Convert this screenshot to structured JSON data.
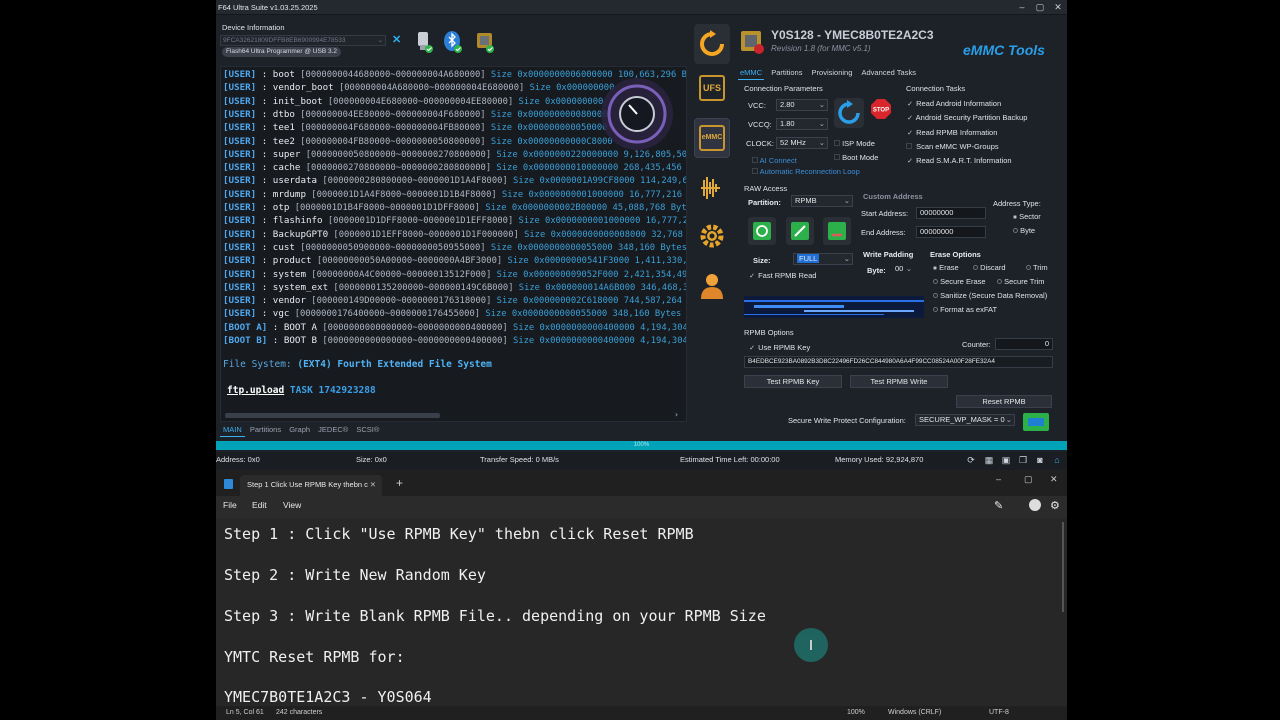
{
  "app": {
    "title": "F64 Ultra Suite v1.03.25.2025",
    "device_info_label": "Device Information",
    "device_select": "9FCA32621809DFFB8EB6900994E78533",
    "port_label": "Flash64 Ultra Programmer @ USB 3.2"
  },
  "log": {
    "rows": [
      {
        "tag": "[USER]",
        "name": " : boot",
        "range": " [0000000044680000~000000004A680000]",
        "size": " Size 0x0000000006000000 100,663,296 Byte"
      },
      {
        "tag": "[USER]",
        "name": " : vendor_boot",
        "range": " [000000004A680000~000000004E680000]",
        "size": " Size 0x000000000"
      },
      {
        "tag": "[USER]",
        "name": " : init_boot",
        "range": " [000000004E680000~000000004EE80000]",
        "size": " Size 0x000000000"
      },
      {
        "tag": "[USER]",
        "name": " : dtbo",
        "range": " [000000004EE80000~000000004F680000]",
        "size": " Size 0x000000000080000"
      },
      {
        "tag": "[USER]",
        "name": " : tee1",
        "range": " [000000004F680000~000000004FB80000]",
        "size": " Size 0x000000000050000"
      },
      {
        "tag": "[USER]",
        "name": " : tee2",
        "range": " [000000004FB80000~0000000050800000]",
        "size": " Size 0x00000000000C8000"
      },
      {
        "tag": "[USER]",
        "name": " : super",
        "range": " [0000000050800000~0000000270800000]",
        "size": " Size 0x0000000220000000 9,126,805,504 B"
      },
      {
        "tag": "[USER]",
        "name": " : cache",
        "range": " [0000000270800000~0000000280800000]",
        "size": " Size 0x0000000010000000 268,435,456 Byt"
      },
      {
        "tag": "[USER]",
        "name": " : userdata",
        "range": " [0000000280800000~0000001D1A4F8000]",
        "size": " Size 0x0000001A99CF8000 114,249,662"
      },
      {
        "tag": "[USER]",
        "name": " : mrdump",
        "range": " [0000001D1A4F8000~0000001D1B4F8000]",
        "size": " Size 0x0000000001000000 16,777,216"
      },
      {
        "tag": "[USER]",
        "name": " : otp",
        "range": " [0000001D1B4F8000~0000001D1DFF8000]",
        "size": " Size 0x0000000002B00000 45,088,768 Bytes"
      },
      {
        "tag": "[USER]",
        "name": " : flashinfo",
        "range": " [0000001D1DFF8000~0000001D1EFF8000]",
        "size": " Size 0x0000000001000000 16,777,216"
      },
      {
        "tag": "[USER]",
        "name": " : BackupGPT0",
        "range": " [0000001D1EFF8000~0000001D1F000000]",
        "size": " Size 0x0000000000008000 32,768 B"
      },
      {
        "tag": "[USER]",
        "name": " : cust",
        "range": " [0000000050900000~0000000050955000]",
        "size": " Size 0x0000000000055000 348,160 Bytes (34"
      },
      {
        "tag": "[USER]",
        "name": " : product",
        "range": " [00000000050A00000~0000000A4BF3000]",
        "size": " Size 0x00000000541F3000 1,411,330,04"
      },
      {
        "tag": "[USER]",
        "name": " : system",
        "range": " [00000000A4C00000~00000013512F000]",
        "size": " Size 0x000000009052F000 2,421,354,496"
      },
      {
        "tag": "[USER]",
        "name": " : system_ext",
        "range": " [0000000135200000~000000149C6B000]",
        "size": " Size 0x000000014A6B000 346,468,3"
      },
      {
        "tag": "[USER]",
        "name": " : vendor",
        "range": " [000000149D00000~0000000176318000]",
        "size": " Size 0x000000002C618000 744,587,264 B"
      },
      {
        "tag": "[USER]",
        "name": " : vgc",
        "range": " [0000000176400000~0000000176455000]",
        "size": " Size 0x0000000000055000 348,160 Bytes (34"
      },
      {
        "tag": "[BOOT A]",
        "name": " : BOOT A",
        "range": " [0000000000000000~0000000000400000]",
        "size": " Size 0x0000000000400000 4,194,304 B"
      },
      {
        "tag": "[BOOT B]",
        "name": " : BOOT B",
        "range": " [0000000000000000~0000000000400000]",
        "size": " Size 0x0000000000400000 4,194,304 B"
      }
    ],
    "fs_label": "File System: ",
    "fs_value": "(EXT4) Fourth Extended File System",
    "ftp_label": "ftp.upload",
    "ftp_task": " TASK 1742923288",
    "tabs": [
      "MAIN",
      "Partitions",
      "Graph",
      "JEDEC®",
      "SCSI®"
    ]
  },
  "progress": {
    "text": "100%",
    "value": 1.0
  },
  "status": {
    "address": "Address: 0x0",
    "size": "Size: 0x0",
    "speed": "Transfer Speed: 0 MB/s",
    "eta": "Estimated Time Left: 00:00:00",
    "memory": "Memory Used: 92,924,870"
  },
  "header": {
    "title": "Y0S128 - YMEC8B0TE2A2C3",
    "revision": "Revision 1.8 (for MMC v5.1)",
    "brand": "eMMC Tools",
    "tabs": [
      "eMMC",
      "Partitions",
      "Provisioning",
      "Advanced Tasks"
    ],
    "sidebar_ufs": "UFS",
    "sidebar_emmc": "eMMC",
    "stop_label": "STOP"
  },
  "conn": {
    "group_label": "Connection Parameters",
    "vcc_label": "VCC:",
    "vcc_value": "2.80",
    "vccq_label": "VCCQ:",
    "vccq_value": "1.80",
    "clock_label": "CLOCK:",
    "clock_value": "52 MHz",
    "isp_label": "ISP Mode",
    "boot_label": "Boot Mode",
    "ai_connect": "AI Connect",
    "auto_reconnect": "Automatic Reconnection Loop"
  },
  "tasks": {
    "group_label": "Connection Tasks",
    "items": [
      {
        "label": "Read Android Information",
        "checked": true
      },
      {
        "label": "Android Security Partition Backup",
        "checked": true
      },
      {
        "label": "Read RPMB Information",
        "checked": true
      },
      {
        "label": "Scan eMMC WP-Groups",
        "checked": false
      },
      {
        "label": "Read S.M.A.R.T. Information",
        "checked": true
      }
    ]
  },
  "raw": {
    "group_label": "RAW Access",
    "partition_label": "Partition:",
    "partition_value": "RPMB",
    "size_label": "Size:",
    "size_value": "FULL",
    "fast_rpmb": "Fast RPMB Read",
    "custom_label": "Custom Address",
    "start_label": "Start Address:",
    "start_value": "00000000",
    "end_label": "End Address:",
    "end_value": "00000000",
    "addr_type_label": "Address Type:",
    "sector": "Sector",
    "byte": "Byte",
    "write_padding": "Write Padding",
    "byte_label": "Byte:",
    "byte_value": "00",
    "erase_label": "Erase Options",
    "erase": "Erase",
    "discard": "Discard",
    "trim": "Trim",
    "secure_erase": "Secure Erase",
    "secure_trim": "Secure Trim",
    "sanitize": "Sanitize (Secure Data Removal)",
    "exfat": "Format as exFAT"
  },
  "rpmb": {
    "group_label": "RPMB Options",
    "use_key": "Use RPMB Key",
    "counter_label": "Counter:",
    "counter_value": "0",
    "key": "B4EDBCE923BA0892B3D8C22496FD26CC844980A6A4F99CC08524A00F28FE32A4",
    "test_key": "Test RPMB Key",
    "test_write": "Test RPMB Write",
    "reset": "Reset RPMB",
    "swp_label": "Secure Write Protect Configuration:",
    "swp_value": "SECURE_WP_MASK = 0"
  },
  "notepad": {
    "tab_title": "Step 1  Click Use RPMB Key thebn c",
    "menu": [
      "File",
      "Edit",
      "View"
    ],
    "lines": [
      "Step 1 : Click \"Use RPMB Key\" thebn click Reset RPMB",
      "Step 2 : Write New Random Key",
      "Step 3 : Write Blank RPMB File.. depending on your RPMB Size",
      "YMTC Reset RPMB for:",
      "YMEC7B0TE1A2C3 - Y0S064"
    ],
    "status_pos": "Ln 5, Col 61",
    "status_chars": "242 characters",
    "status_zoom": "100%",
    "status_eol": "Windows (CRLF)",
    "status_enc": "UTF-8"
  },
  "colors": {
    "accent": "#3ab0f0",
    "progress": "#00a3b8",
    "log_size": "#3aa0d8",
    "brand": "#2a9fe8"
  }
}
